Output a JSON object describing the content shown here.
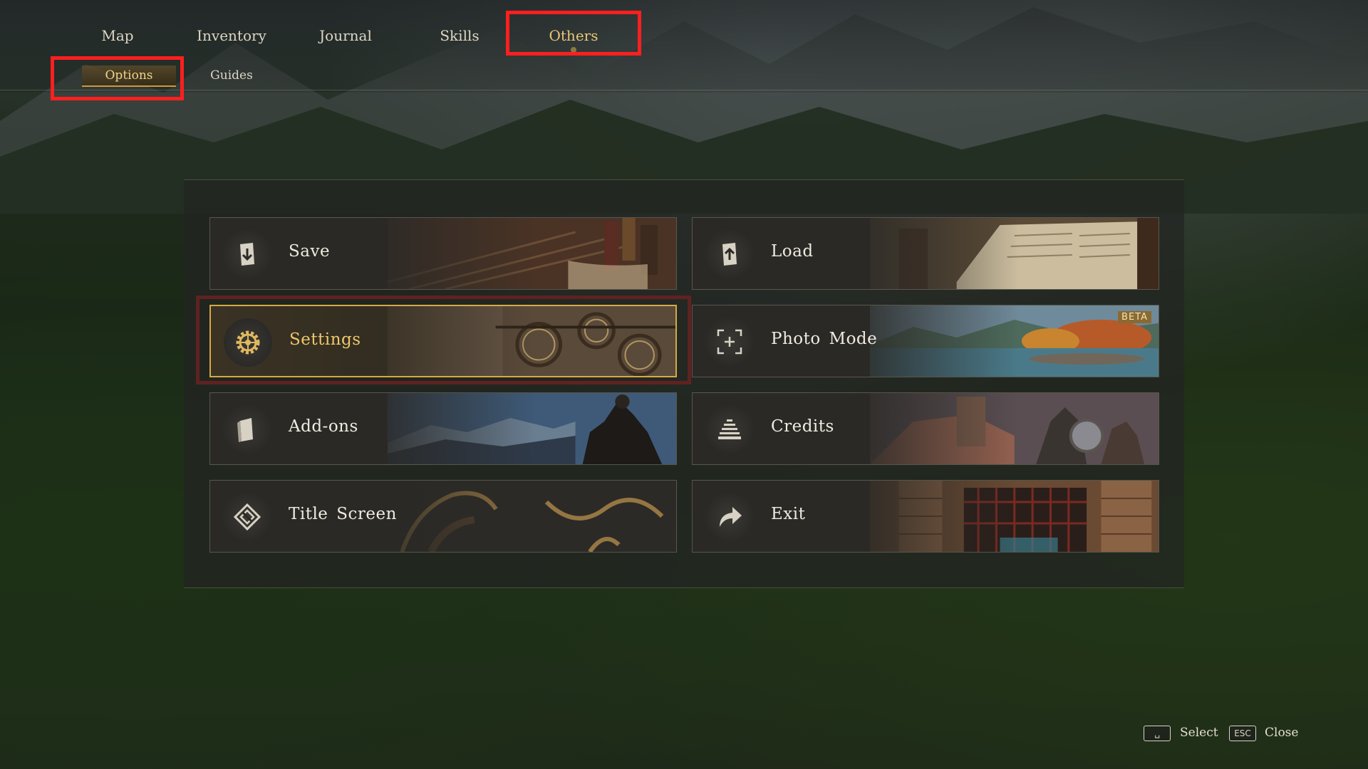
{
  "nav": {
    "tabs": [
      {
        "label": "Map"
      },
      {
        "label": "Inventory"
      },
      {
        "label": "Journal"
      },
      {
        "label": "Skills"
      },
      {
        "label": "Others",
        "active": true
      }
    ],
    "subtabs": [
      {
        "label": "Options",
        "active": true
      },
      {
        "label": "Guides"
      }
    ]
  },
  "menu": {
    "items": [
      {
        "label": "Save",
        "icon": "save-scroll-icon"
      },
      {
        "label": "Load",
        "icon": "load-scroll-icon"
      },
      {
        "label": "Settings",
        "icon": "gear-icon",
        "selected": true
      },
      {
        "label": "Photo Mode",
        "icon": "camera-frame-icon",
        "badge": "BETA"
      },
      {
        "label": "Add-ons",
        "icon": "book-icon"
      },
      {
        "label": "Credits",
        "icon": "credits-stack-icon"
      },
      {
        "label": "Title Screen",
        "icon": "diamond-emblem-icon"
      },
      {
        "label": "Exit",
        "icon": "exit-arrow-icon"
      }
    ]
  },
  "footer": {
    "select_key": "␣",
    "select_label": "Select",
    "close_key": "ESC",
    "close_label": "Close"
  },
  "colors": {
    "accent_gold": "#e8c777",
    "highlight_red": "#ff1f1f"
  }
}
